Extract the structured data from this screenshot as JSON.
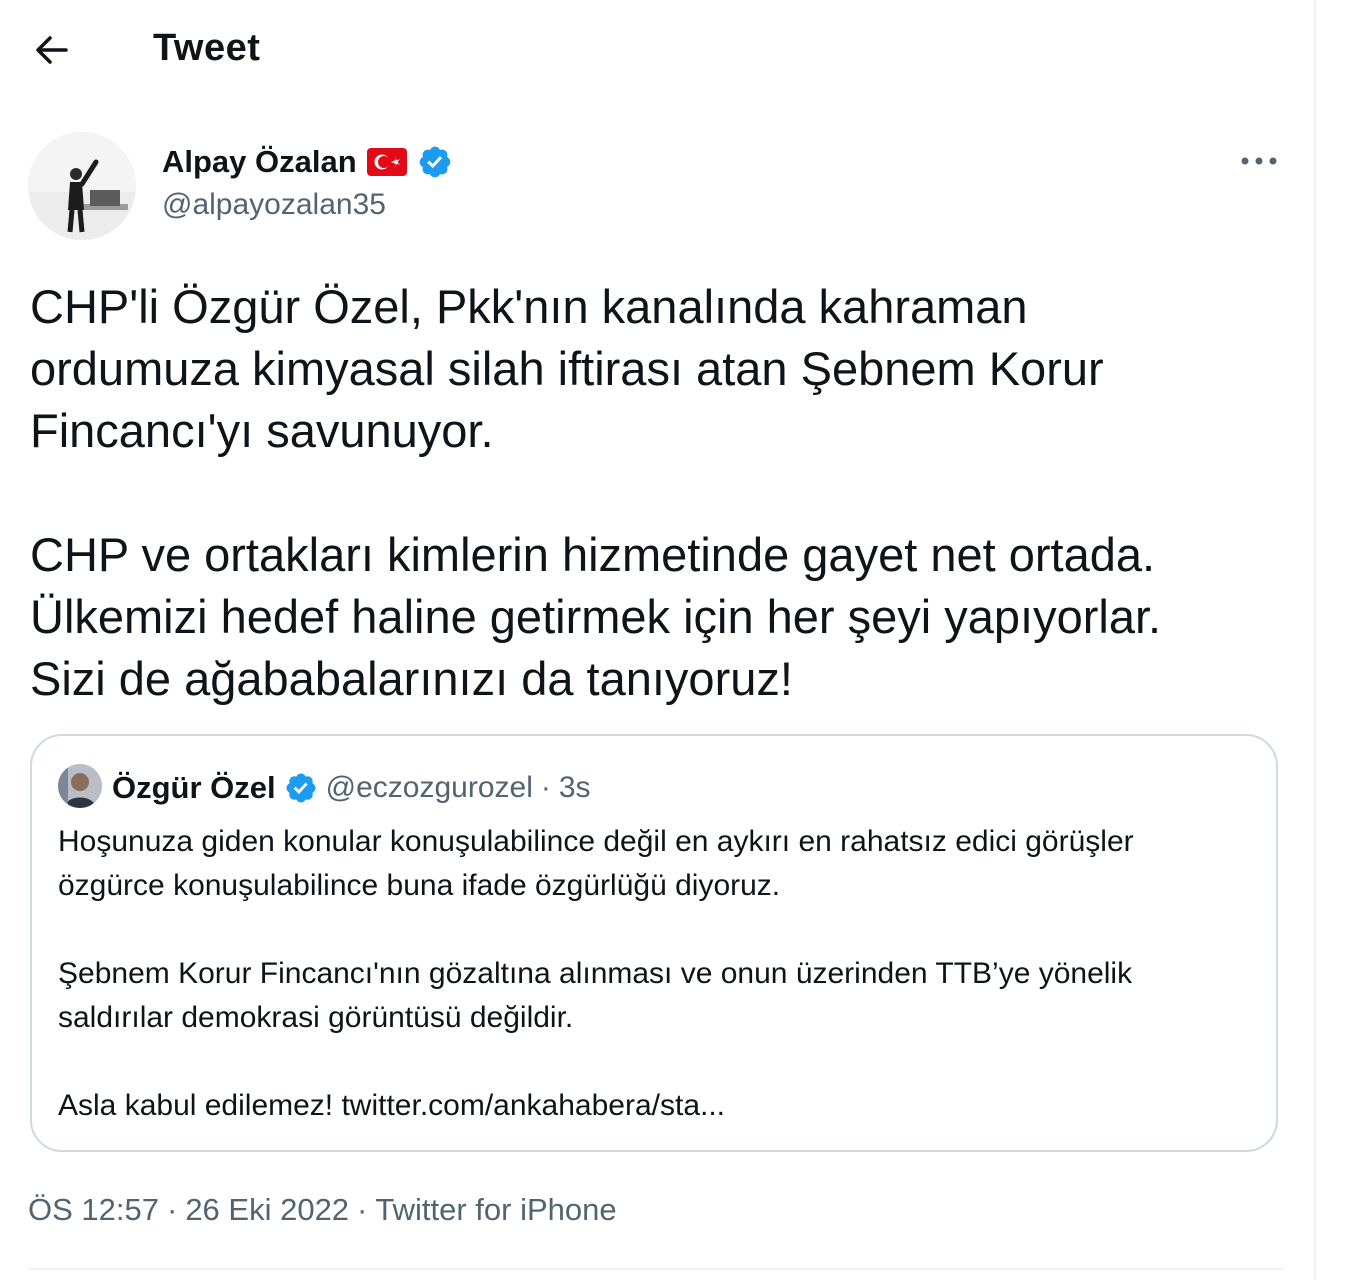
{
  "header": {
    "title": "Tweet"
  },
  "author": {
    "name": "Alpay Özalan",
    "handle": "@alpayozalan35"
  },
  "tweet": {
    "text": "CHP'li Özgür Özel, Pkk'nın kanalında kahraman\nordumuza kimyasal silah iftirası atan Şebnem Korur\nFincancı'yı savunuyor.\n\nCHP ve ortakları kimlerin hizmetinde gayet net ortada.\nÜlkemizi hedef haline getirmek için her şeyi yapıyorlar.\nSizi de ağababalarınızı da tanıyoruz!"
  },
  "quote": {
    "name": "Özgür Özel",
    "handle": "@eczozgurozel",
    "separator": "·",
    "time": "3s",
    "text": "Hoşunuza giden konular konuşulabilince değil en aykırı en rahatsız edici görüşler\nözgürce konuşulabilince buna ifade özgürlüğü diyoruz.\n\nŞebnem Korur Fincancı'nın gözaltına alınması ve onun üzerinden TTB’ye yönelik\nsaldırılar demokrasi görüntüsü değildir.\n\nAsla kabul edilemez! twitter.com/ankahabera/sta..."
  },
  "meta": {
    "time": "ÖS 12:57",
    "sep1": "·",
    "date": "26 Eki 2022",
    "sep2": "·",
    "source": "Twitter for iPhone"
  },
  "icons": {
    "back": "arrow-left-icon",
    "more": "more-horizontal-icon",
    "verified": "verified-badge-icon",
    "flag": "turkey-flag-icon"
  },
  "colors": {
    "verified": "#1d9bf0",
    "secondary_text": "#536471",
    "flag_red": "#e30a17",
    "border": "#cfd9de"
  }
}
